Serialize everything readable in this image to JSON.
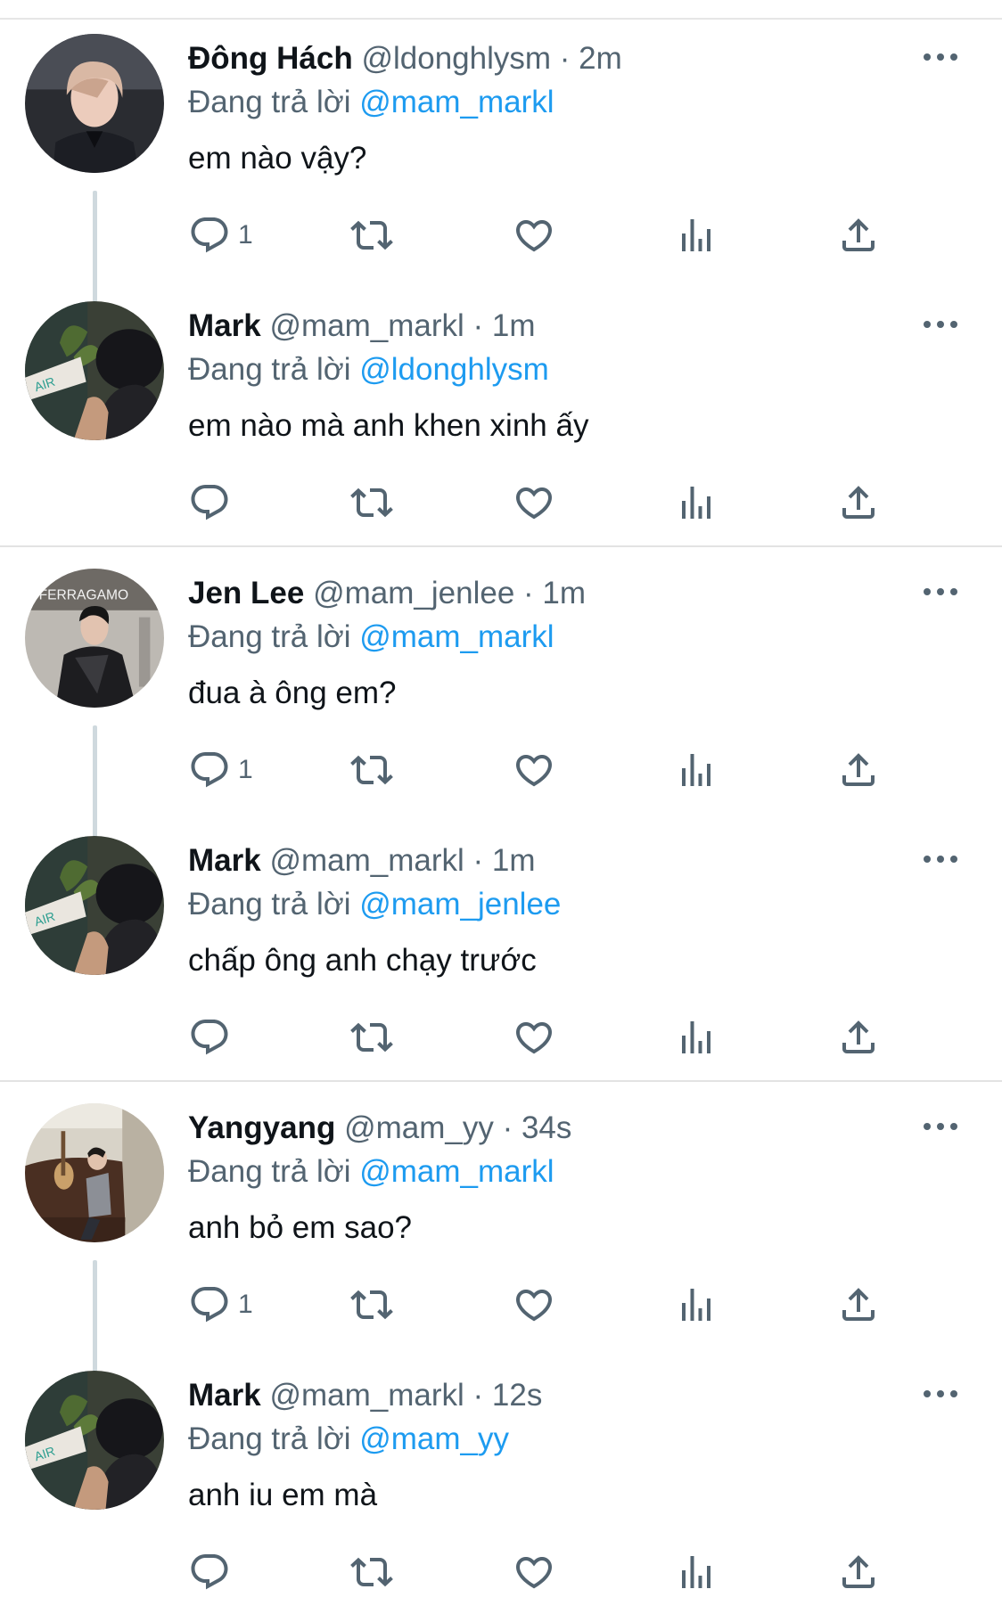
{
  "thread": [
    {
      "tweets": [
        {
          "name": "Đông Hách",
          "handle": "@ldonghlysm",
          "time": "2m",
          "replying_label": "Đang trả lời",
          "replying_to": "@mam_markl",
          "text": "em nào vậy?",
          "reply_count": "1",
          "avatar": "avatar-donghach"
        },
        {
          "name": "Mark",
          "handle": "@mam_markl",
          "time": "1m",
          "replying_label": "Đang trả lời",
          "replying_to": "@ldonghlysm",
          "text": "em nào mà anh khen xinh ấy",
          "reply_count": "",
          "avatar": "avatar-mark"
        }
      ]
    },
    {
      "tweets": [
        {
          "name": "Jen Lee",
          "handle": "@mam_jenlee",
          "time": "1m",
          "replying_label": "Đang trả lời",
          "replying_to": "@mam_markl",
          "text": "đua à ông em?",
          "reply_count": "1",
          "avatar": "avatar-jenlee"
        },
        {
          "name": "Mark",
          "handle": "@mam_markl",
          "time": "1m",
          "replying_label": "Đang trả lời",
          "replying_to": "@mam_jenlee",
          "text": "chấp ông anh chạy trước",
          "reply_count": "",
          "avatar": "avatar-mark"
        }
      ]
    },
    {
      "tweets": [
        {
          "name": "Yangyang",
          "handle": "@mam_yy",
          "time": "34s",
          "replying_label": "Đang trả lời",
          "replying_to": "@mam_markl",
          "text": "anh bỏ em sao?",
          "reply_count": "1",
          "avatar": "avatar-yangyang"
        },
        {
          "name": "Mark",
          "handle": "@mam_markl",
          "time": "12s",
          "replying_label": "Đang trả lời",
          "replying_to": "@mam_yy",
          "text": "anh iu em mà",
          "reply_count": "",
          "avatar": "avatar-mark"
        }
      ]
    }
  ],
  "separator": "·",
  "avatar_texts": {
    "jenlee": "FERRAGAMO",
    "mark": "AIR"
  },
  "action_icons": [
    "reply-icon",
    "retweet-icon",
    "like-icon",
    "views-icon",
    "share-icon"
  ],
  "colors": {
    "accent": "#1d9bf0",
    "secondary": "#536471",
    "primary": "#0f1419",
    "thread_line": "#cfd9de"
  }
}
